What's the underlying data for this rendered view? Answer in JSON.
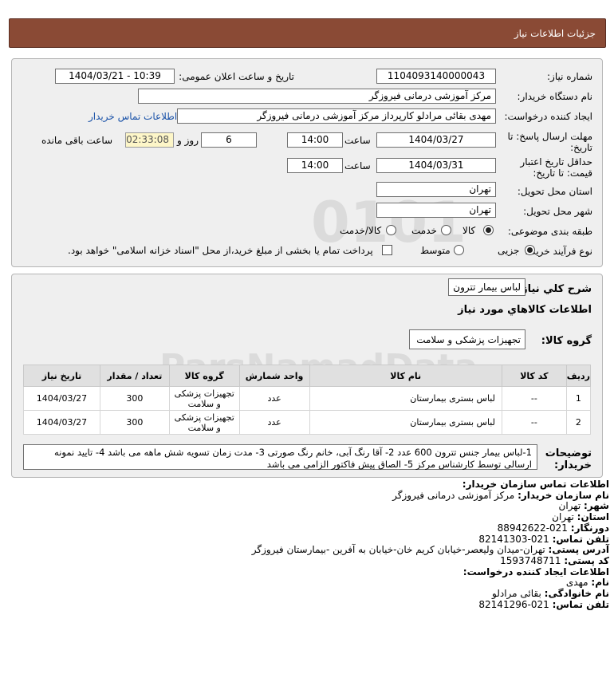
{
  "header": {
    "title": "جزئیات اطلاعات نیاز"
  },
  "form": {
    "need_number_label": "شماره نیاز:",
    "need_number": "1104093140000043",
    "announce_label": "تاریخ و ساعت اعلان عمومی:",
    "announce_value": "1404/03/21 - 10:39",
    "buyer_org_label": "نام دستگاه خریدار:",
    "buyer_org": "مرکز آموزشی درمانی فیروزگر",
    "creator_label": "ایجاد کننده درخواست:",
    "creator": "مهدی بقائی مرادلو کارپرداز مرکز آموزشی درمانی فیروزگر",
    "contact_link": "اطلاعات تماس خریدار",
    "deadline_label_1": "مهلت ارسال پاسخ: تا",
    "deadline_label_2": "تاریخ:",
    "deadline_date": "1404/03/27",
    "time_label": "ساعت",
    "deadline_time": "14:00",
    "days_count": "6",
    "days_label": "روز و",
    "remaining_time": "02:33:08",
    "remaining_label": "ساعت باقی مانده",
    "validity_label_1": "حداقل تاریخ اعتبار",
    "validity_label_2": "قیمت: تا تاریخ:",
    "validity_date": "1404/03/31",
    "validity_time": "14:00",
    "province_label": "استان محل تحویل:",
    "province": "تهران",
    "city_label": "شهر محل تحویل:",
    "city": "تهران",
    "category_label": "طبقه بندی موضوعی:",
    "category_options": [
      "کالا",
      "خدمت",
      "کالا/خدمت"
    ],
    "process_label": "نوع فرآیند خرید :",
    "process_options": [
      "جزیی",
      "متوسط"
    ],
    "payment_note": "پرداخت تمام یا بخشی از مبلغ خرید،از محل \"اسناد خزانه اسلامی\" خواهد بود."
  },
  "summary": {
    "need_desc_label": "شرح کلي نياز:",
    "need_desc": "لباس بیمار تترون",
    "goods_info_title": "اطلاعات كالاهاي مورد نياز",
    "goods_group_label": "گروه كالا:",
    "goods_group": "تجهیزات پزشکی و سلامت"
  },
  "table": {
    "headers": [
      "ردیف",
      "کد کالا",
      "نام کالا",
      "واحد شمارش",
      "گروه کالا",
      "تعداد / مقدار",
      "تاریخ نیاز"
    ],
    "rows": [
      [
        "1",
        "--",
        "لباس بستری بیمارستان",
        "عدد",
        "تجهیزات پزشکی و سلامت",
        "300",
        "1404/03/27"
      ],
      [
        "2",
        "--",
        "لباس بستری بیمارستان",
        "عدد",
        "تجهیزات پزشکی و سلامت",
        "300",
        "1404/03/27"
      ]
    ]
  },
  "buyer_notes": {
    "label_1": "توضیحات",
    "label_2": "خریدار:",
    "text": "1-لباس بیمار جنس تترون 600 عدد 2- آقا رنگ آبی، خانم رنگ صورتی 3- مدت زمان تسویه شش ماهه می باشد 4- تایید نمونه ارسالی توسط کارشناس مرکز 5- الصاق پیش فاکتور الزامی می باشد"
  },
  "contact": {
    "title": "اطلاعات تماس سازمان خریدار:",
    "org_label": "نام سازمان خریدار:",
    "org": "مرکز آموزشی درمانی فیروزگر",
    "city_label": "شهر:",
    "city": "تهران",
    "province_label": "استان:",
    "province": "تهران",
    "fax_label": "دورنگار:",
    "fax": "021-88942622",
    "phone_label": "تلفن تماس:",
    "phone": "021-82141303",
    "address_label": "آدرس پستی:",
    "address": "تهران-میدان ولیعصر-خیابان کریم خان-خیابان به آفرین -بیمارستان فیروزگر",
    "postal_label": "کد پستی:",
    "postal": "1593748711",
    "creator_title": "اطلاعات ایجاد کننده درخواست:",
    "name_label": "نام:",
    "name": "مهدی",
    "family_label": "نام خانوادگی:",
    "family": "بقائی مرادلو",
    "creator_phone_label": "تلفن تماس:",
    "creator_phone": "021-82141296"
  },
  "watermark": {
    "brand": "ParsNamadData",
    "digits": "0101"
  }
}
